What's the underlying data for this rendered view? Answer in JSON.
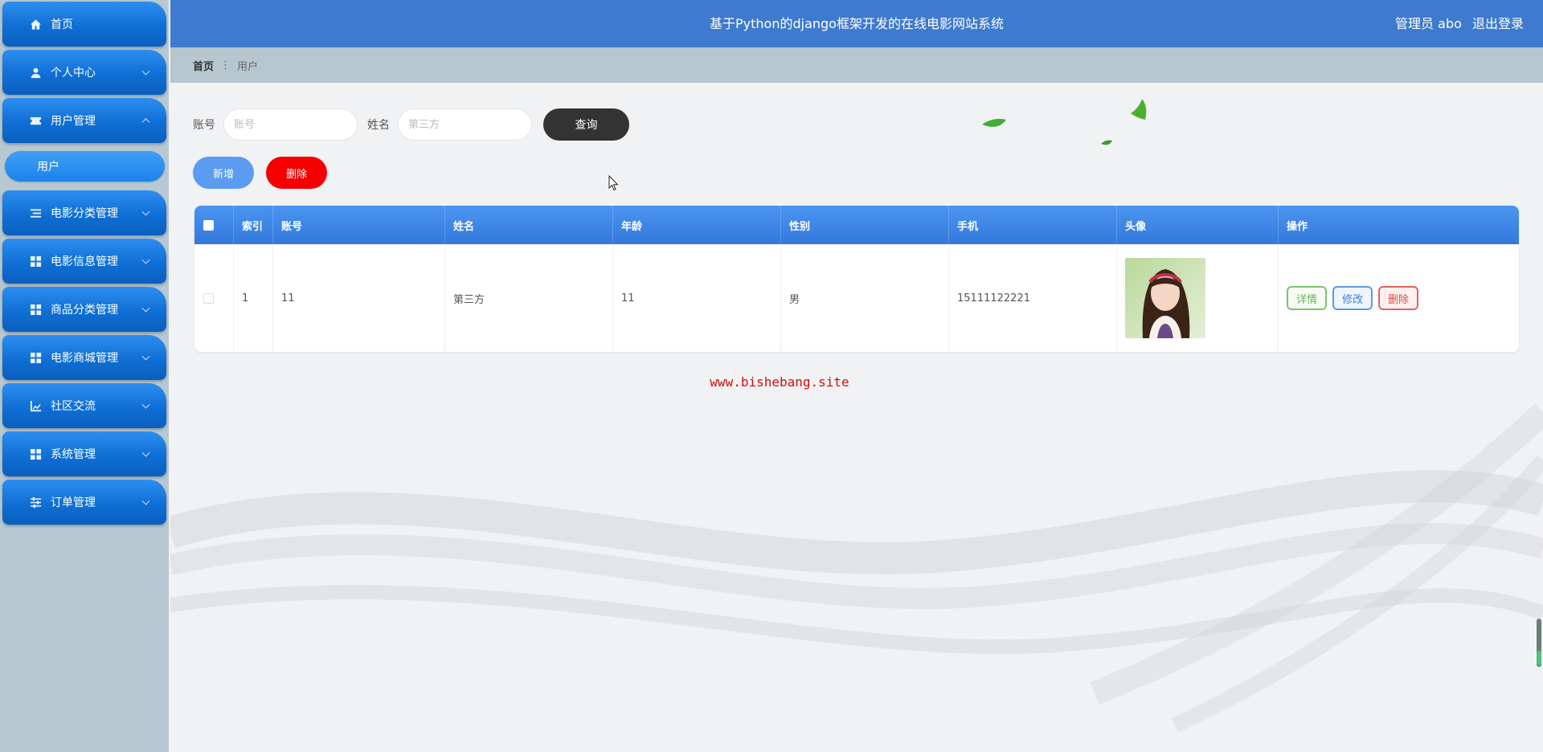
{
  "sidebar": {
    "items": [
      {
        "label": "首页",
        "icon": "home-icon"
      },
      {
        "label": "个人中心",
        "icon": "person-icon"
      },
      {
        "label": "用户管理",
        "icon": "ticket-icon",
        "expanded": true
      },
      {
        "label": "电影分类管理",
        "icon": "list-icon"
      },
      {
        "label": "电影信息管理",
        "icon": "grid-icon"
      },
      {
        "label": "商品分类管理",
        "icon": "grid-icon"
      },
      {
        "label": "电影商城管理",
        "icon": "grid-icon"
      },
      {
        "label": "社区交流",
        "icon": "chart-icon"
      },
      {
        "label": "系统管理",
        "icon": "grid-icon"
      },
      {
        "label": "订单管理",
        "icon": "sliders-icon"
      }
    ],
    "sub_items": [
      {
        "label": "用户"
      }
    ]
  },
  "header": {
    "title": "基于Python的django框架开发的在线电影网站系统",
    "user_label": "管理员 abo",
    "logout": "退出登录"
  },
  "breadcrumb": {
    "home": "首页",
    "current": "用户"
  },
  "search": {
    "account_label": "账号",
    "account_placeholder": "账号",
    "name_label": "姓名",
    "name_placeholder": "第三方",
    "query_button": "查询"
  },
  "actions": {
    "add": "新增",
    "delete": "删除"
  },
  "table": {
    "columns": [
      "索引",
      "账号",
      "姓名",
      "年龄",
      "性别",
      "手机",
      "头像",
      "操作"
    ],
    "rows": [
      {
        "index": "1",
        "account": "11",
        "name": "第三方",
        "age": "11",
        "gender": "男",
        "phone": "15111122221"
      }
    ],
    "row_actions": {
      "detail": "详情",
      "edit": "修改",
      "remove": "删除"
    }
  },
  "watermark": "www.bishebang.site",
  "colors": {
    "header": "#3e7ace",
    "menu": "#0f6fd4",
    "query_button": "#333333",
    "add_button": "#5b9cf0",
    "delete_button": "#f40000",
    "watermark": "#d10e0e"
  }
}
